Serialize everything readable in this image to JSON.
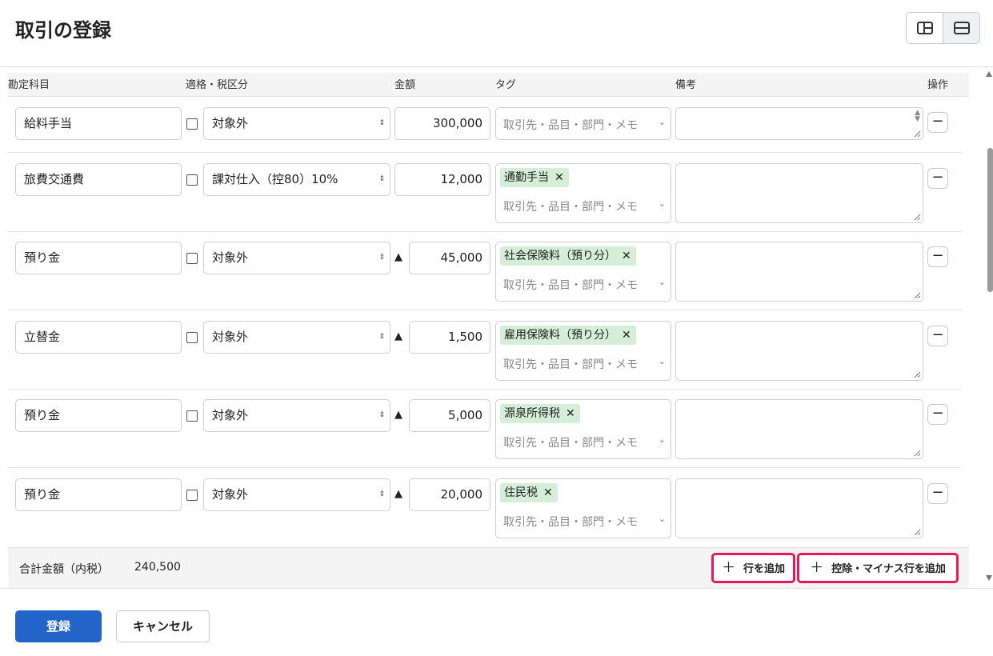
{
  "page": {
    "title": "取引の登録"
  },
  "view_toggle": {
    "icons": [
      "split-vertical-icon",
      "split-horizontal-icon"
    ],
    "active": 1
  },
  "columns": {
    "account": "勘定科目",
    "tax": "適格・税区分",
    "amount": "金額",
    "tag": "タグ",
    "memo": "備考",
    "ops": "操作"
  },
  "rows": [
    {
      "account": "給料手当",
      "tax": "対象外",
      "minus_mark": "",
      "amount": "300,000",
      "tag": "",
      "tag_placeholder": "取引先・品目・部門・メモ",
      "memo": ""
    },
    {
      "account": "旅費交通費",
      "tax": "課対仕入（控80）10%",
      "minus_mark": "",
      "amount": "12,000",
      "tag": "通勤手当",
      "tag_placeholder": "取引先・品目・部門・メモ",
      "memo": ""
    },
    {
      "account": "預り金",
      "tax": "対象外",
      "minus_mark": "▲",
      "amount": "45,000",
      "tag": "社会保険料（預り分）",
      "tag_placeholder": "取引先・品目・部門・メモ",
      "memo": ""
    },
    {
      "account": "立替金",
      "tax": "対象外",
      "minus_mark": "▲",
      "amount": "1,500",
      "tag": "雇用保険料（預り分）",
      "tag_placeholder": "取引先・品目・部門・メモ",
      "memo": ""
    },
    {
      "account": "預り金",
      "tax": "対象外",
      "minus_mark": "▲",
      "amount": "5,000",
      "tag": "源泉所得税",
      "tag_placeholder": "取引先・品目・部門・メモ",
      "memo": ""
    },
    {
      "account": "預り金",
      "tax": "対象外",
      "minus_mark": "▲",
      "amount": "20,000",
      "tag": "住民税",
      "tag_placeholder": "取引先・品目・部門・メモ",
      "memo": ""
    }
  ],
  "chip_remove": "✕",
  "tag_chevron": "⌄",
  "tax_arrows": "⇕",
  "remove_row": "−",
  "footer": {
    "total_label": "合計金額（内税）",
    "total_value": "240,500",
    "add_row": "行を追加",
    "add_deduction_row": "控除・マイナス行を追加",
    "plus": "＋"
  },
  "actions": {
    "submit": "登録",
    "cancel": "キャンセル"
  },
  "colors": {
    "accent": "#2264c8",
    "highlight": "#e8195a",
    "chip": "#d5eed8"
  }
}
